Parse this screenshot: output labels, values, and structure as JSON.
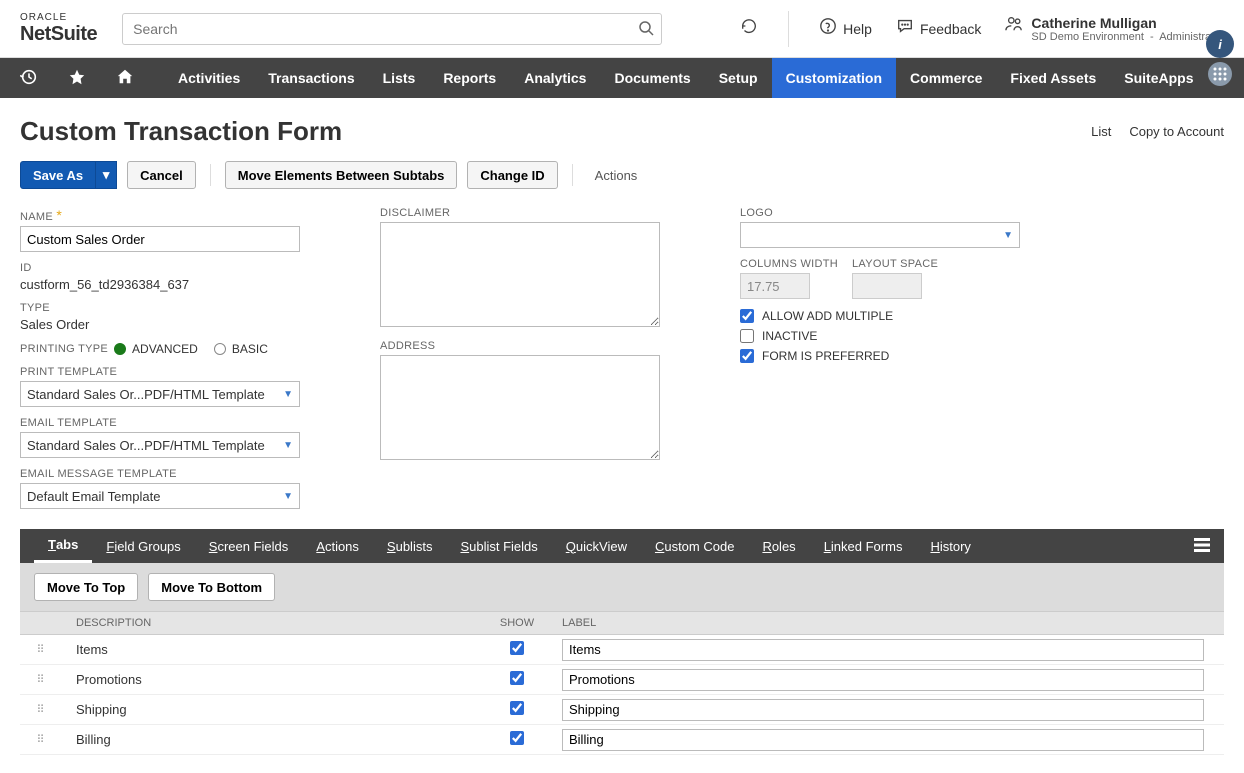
{
  "topbar": {
    "logo_top": "ORACLE",
    "logo_bottom": "NetSuite",
    "search_placeholder": "Search",
    "help": "Help",
    "feedback": "Feedback",
    "user_name": "Catherine Mulligan",
    "user_env": "SD Demo Environment",
    "user_role": "Administrator"
  },
  "nav": [
    "Activities",
    "Transactions",
    "Lists",
    "Reports",
    "Analytics",
    "Documents",
    "Setup",
    "Customization",
    "Commerce",
    "Fixed Assets",
    "SuiteApps"
  ],
  "nav_active": "Customization",
  "page": {
    "title": "Custom Transaction Form",
    "links": [
      "List",
      "Copy to Account"
    ]
  },
  "actions": {
    "save_as": "Save As",
    "cancel": "Cancel",
    "move_between": "Move Elements Between Subtabs",
    "change_id": "Change ID",
    "actions": "Actions"
  },
  "form": {
    "name_label": "NAME",
    "name_value": "Custom Sales Order",
    "id_label": "ID",
    "id_value": "custform_56_td2936384_637",
    "type_label": "TYPE",
    "type_value": "Sales Order",
    "printing_type_label": "PRINTING TYPE",
    "printing_adv": "ADVANCED",
    "printing_basic": "BASIC",
    "print_template_label": "PRINT TEMPLATE",
    "print_template_value": "Standard Sales Or...PDF/HTML Template",
    "email_template_label": "EMAIL TEMPLATE",
    "email_template_value": "Standard Sales Or...PDF/HTML Template",
    "email_msg_label": "EMAIL MESSAGE TEMPLATE",
    "email_msg_value": "Default Email Template",
    "disclaimer_label": "DISCLAIMER",
    "address_label": "ADDRESS",
    "logo_label": "LOGO",
    "columns_width_label": "COLUMNS WIDTH",
    "columns_width_value": "17.75",
    "layout_space_label": "LAYOUT SPACE",
    "allow_multiple": "ALLOW ADD MULTIPLE",
    "inactive": "INACTIVE",
    "preferred": "FORM IS PREFERRED"
  },
  "subtabs": [
    "Tabs",
    "Field Groups",
    "Screen Fields",
    "Actions",
    "Sublists",
    "Sublist Fields",
    "QuickView",
    "Custom Code",
    "Roles",
    "Linked Forms",
    "History"
  ],
  "subtab_active": "Tabs",
  "sub_actions": {
    "move_top": "Move To Top",
    "move_bottom": "Move To Bottom"
  },
  "grid": {
    "headers": {
      "description": "DESCRIPTION",
      "show": "SHOW",
      "label": "LABEL"
    },
    "rows": [
      {
        "desc": "Items",
        "show": true,
        "label": "Items"
      },
      {
        "desc": "Promotions",
        "show": true,
        "label": "Promotions"
      },
      {
        "desc": "Shipping",
        "show": true,
        "label": "Shipping"
      },
      {
        "desc": "Billing",
        "show": true,
        "label": "Billing"
      }
    ]
  }
}
